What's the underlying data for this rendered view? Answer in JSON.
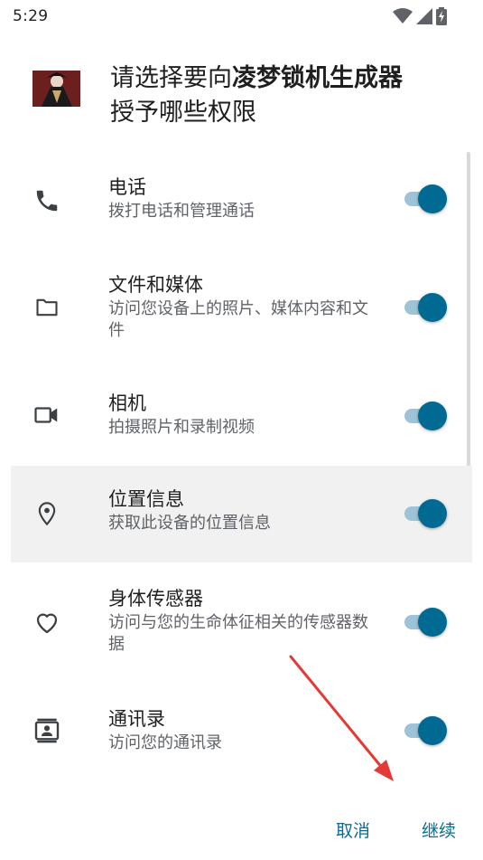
{
  "status_bar": {
    "time": "5:29"
  },
  "header": {
    "title_prefix": "请选择要向",
    "app_name": "凌梦锁机生成器",
    "title_suffix": "授予哪些权限"
  },
  "permissions": [
    {
      "icon": "phone-icon",
      "title": "电话",
      "desc": "拨打电话和管理通话",
      "enabled": true
    },
    {
      "icon": "folder-icon",
      "title": "文件和媒体",
      "desc": "访问您设备上的照片、媒体内容和文件",
      "enabled": true
    },
    {
      "icon": "video-camera-icon",
      "title": "相机",
      "desc": "拍摄照片和录制视频",
      "enabled": true
    },
    {
      "icon": "location-pin-icon",
      "title": "位置信息",
      "desc": "获取此设备的位置信息",
      "enabled": true
    },
    {
      "icon": "heart-icon",
      "title": "身体传感器",
      "desc": "访问与您的生命体征相关的传感器数据",
      "enabled": true
    },
    {
      "icon": "contacts-icon",
      "title": "通讯录",
      "desc": "访问您的通讯录",
      "enabled": true
    }
  ],
  "buttons": {
    "cancel": "取消",
    "continue": "继续"
  },
  "colors": {
    "accent": "#006a93",
    "toggle_track": "#9fc3d6",
    "annotation_arrow": "#e53935"
  }
}
